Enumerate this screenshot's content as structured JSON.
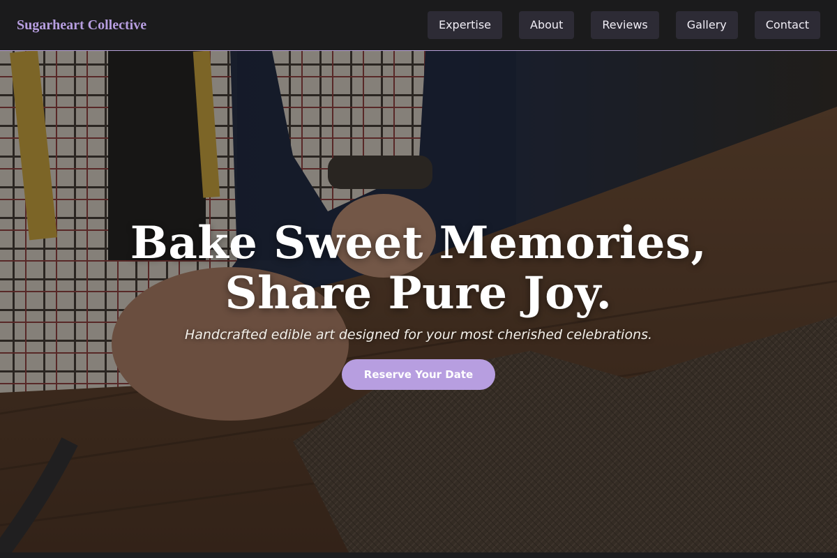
{
  "brand": {
    "name": "Sugarheart Collective"
  },
  "nav": {
    "items": [
      {
        "label": "Expertise"
      },
      {
        "label": "About"
      },
      {
        "label": "Reviews"
      },
      {
        "label": "Gallery"
      },
      {
        "label": "Contact"
      }
    ]
  },
  "hero": {
    "title_line1": "Bake Sweet Memories,",
    "title_line2": "Share Pure Joy.",
    "subtitle": "Handcrafted edible art designed for your most cherished celebrations.",
    "cta_label": "Reserve Your Date",
    "background_icon": "tailor-workbench-photo"
  },
  "colors": {
    "accent": "#b79ee0",
    "nav_bg": "#1b1b1c",
    "nav_button_bg": "#2d2b35",
    "nav_border": "#b9a3dc"
  }
}
